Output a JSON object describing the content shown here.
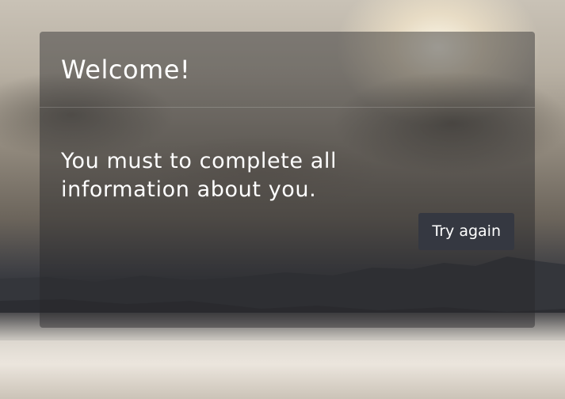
{
  "background": {
    "description_icon": "sunset-clouds-mountains-landscape"
  },
  "modal": {
    "title": "Welcome!",
    "message": "You must to complete all information about you.",
    "button_label": "Try again"
  },
  "colors": {
    "overlay": "#28282a",
    "button": "#353841",
    "text": "#ffffff"
  }
}
